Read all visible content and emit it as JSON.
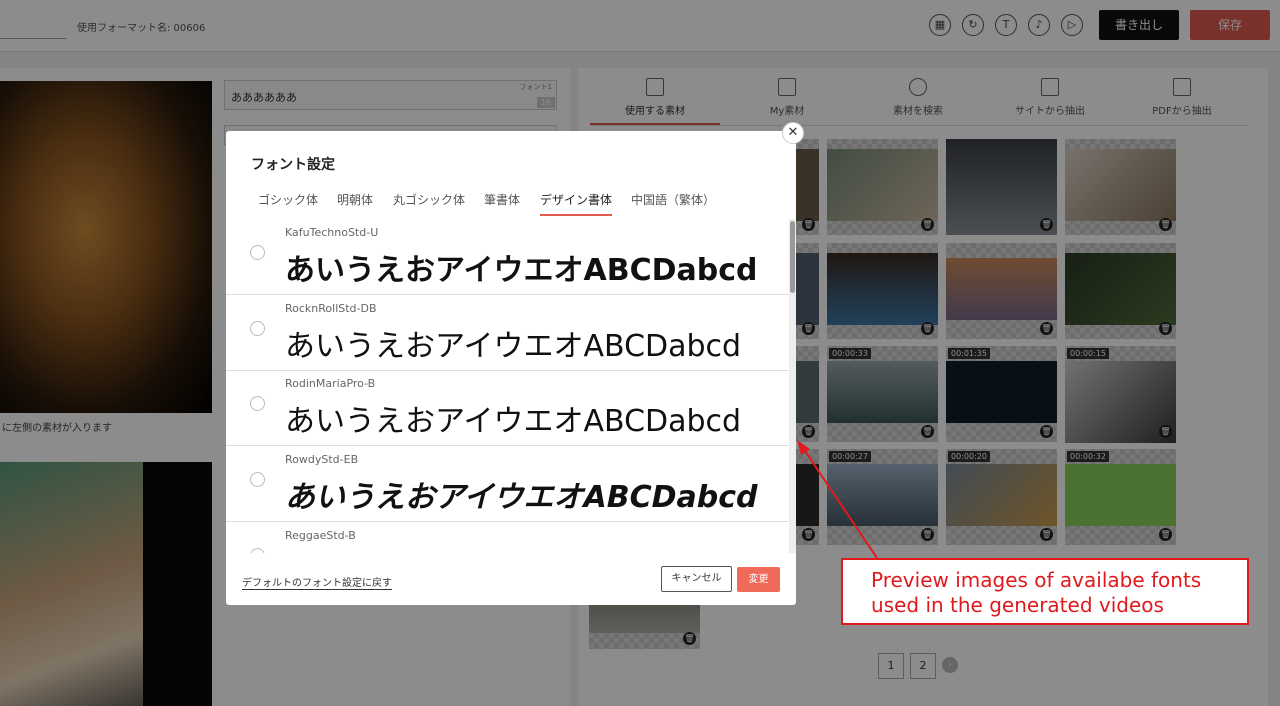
{
  "topbar": {
    "format_name": "使用フォーマット名: 00606",
    "export_label": "書き出し",
    "save_label": "保存",
    "icons": [
      "layout-icon",
      "refresh-icon",
      "text-icon",
      "music-icon",
      "play-icon"
    ]
  },
  "left": {
    "font_field": {
      "value": "ああああああ",
      "tag": "フォント1",
      "size": "16"
    },
    "placeholder_note": "に左側の素材が入ります"
  },
  "right": {
    "tabs": [
      {
        "label": "使用する素材",
        "icon": "grid-icon",
        "active": true
      },
      {
        "label": "My素材",
        "icon": "briefcase-icon"
      },
      {
        "label": "素材を検索",
        "icon": "search-icon"
      },
      {
        "label": "サイトから抽出",
        "icon": "browser-icon"
      },
      {
        "label": "PDFから抽出",
        "icon": "pdf-icon"
      }
    ],
    "durations": [
      "00:00:33",
      "00:01:35",
      "00:00:15",
      "00:00:27",
      "00:00:20",
      "00:00:32"
    ],
    "pages": [
      "1",
      "2"
    ],
    "next_symbol": "›"
  },
  "modal": {
    "title": "フォント設定",
    "close_symbol": "✕",
    "tabs": [
      "ゴシック体",
      "明朝体",
      "丸ゴシック体",
      "筆書体",
      "デザイン書体",
      "中国語（繁体）"
    ],
    "active_tab": "デザイン書体",
    "fonts": [
      {
        "name": "KafuTechnoStd-U",
        "sample": "あいうえおアイウエオABCDabcd"
      },
      {
        "name": "RocknRollStd-DB",
        "sample": "あいうえおアイウエオABCDabcd"
      },
      {
        "name": "RodinMariaPro-B",
        "sample": "あいうえおアイウエオABCDabcd"
      },
      {
        "name": "RowdyStd-EB",
        "sample": "あいうえおアイウエオABCDabcd"
      },
      {
        "name": "ReggaeStd-B",
        "sample": ""
      }
    ],
    "reset_label": "デフォルトのフォント設定に戻す",
    "cancel_label": "キャンセル",
    "change_label": "変更"
  },
  "annotation": {
    "line1": "Preview images of availabe fonts",
    "line2": "used in the generated videos",
    "color": "#e0191d"
  }
}
